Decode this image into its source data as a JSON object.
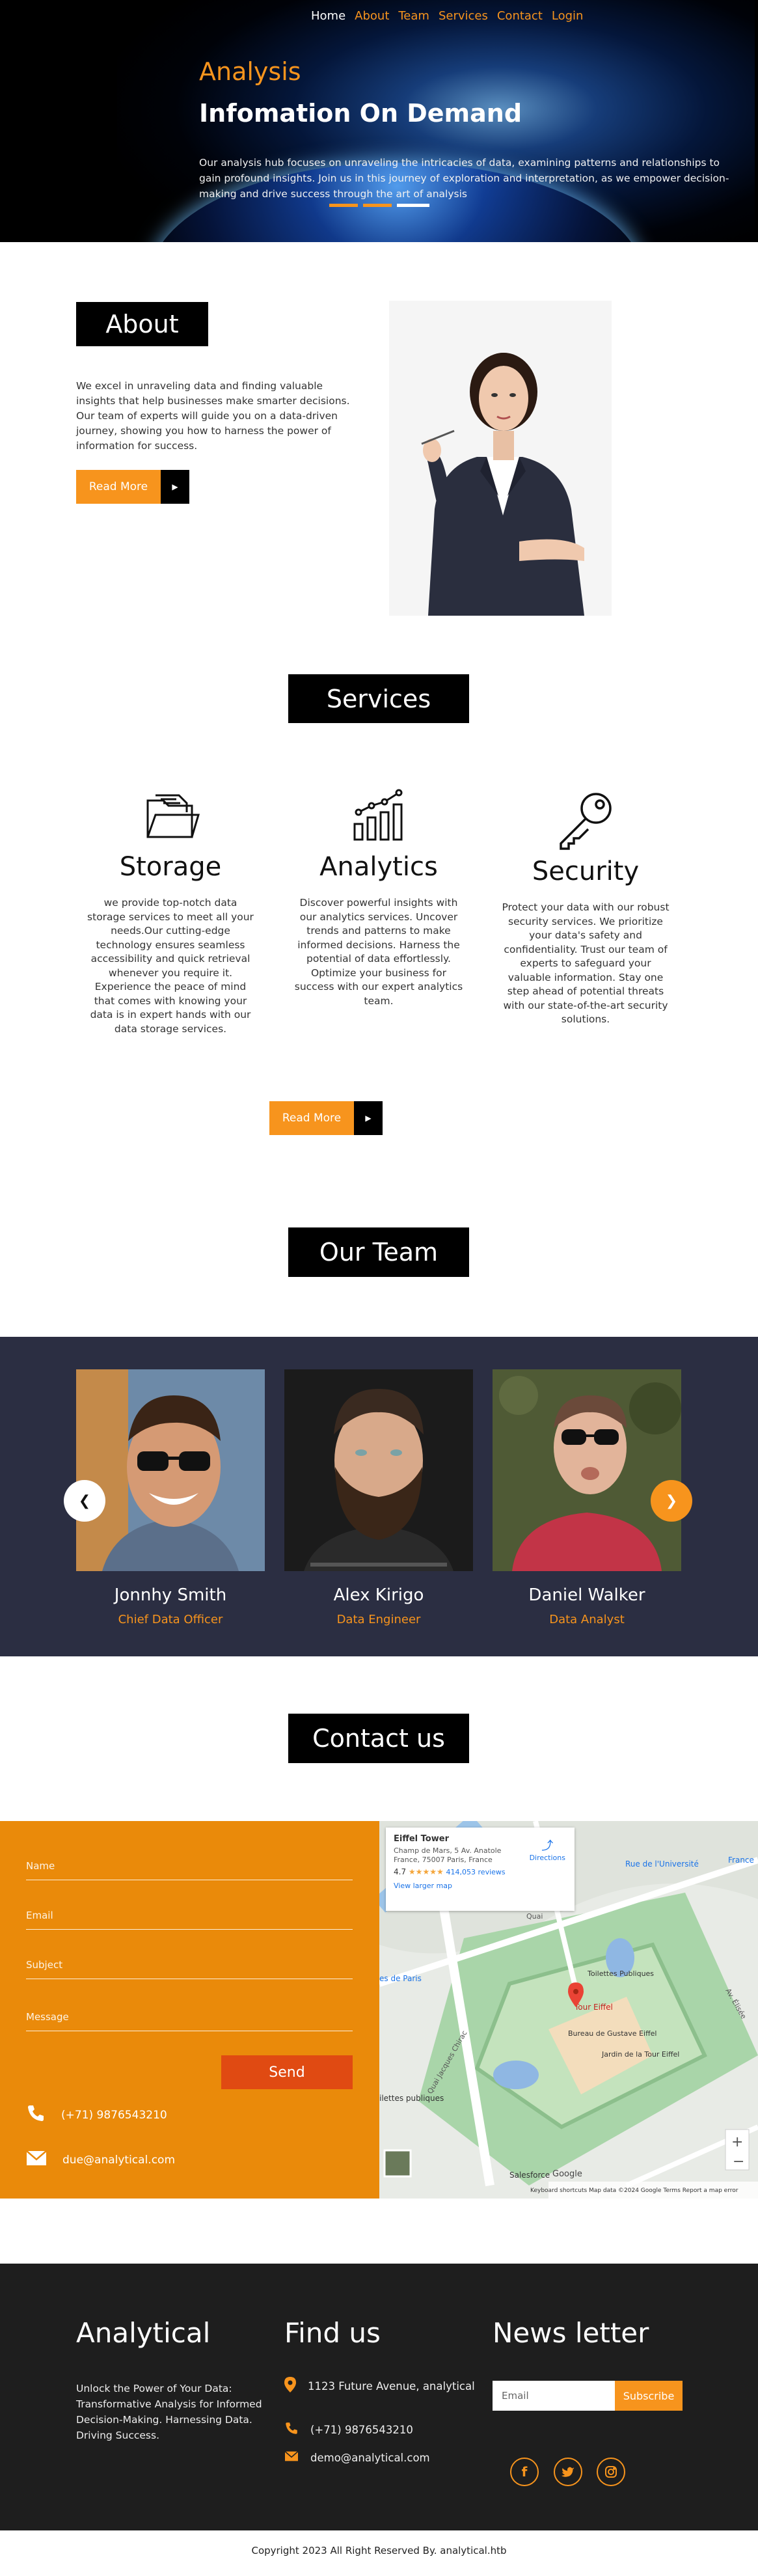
{
  "nav": {
    "items": [
      "Home",
      "About",
      "Team",
      "Services",
      "Contact",
      "Login"
    ]
  },
  "hero": {
    "kicker": "Analysis",
    "title": "Infomation On Demand",
    "lead": "Our analysis hub focuses on unraveling the intricacies of data, examining patterns and relationships to gain profound insights. Join us in this journey of exploration and interpretation, as we empower decision-making and drive success through the art of analysis"
  },
  "about": {
    "heading": "About",
    "text": "We excel in unraveling data and finding valuable insights that help businesses make smarter decisions. Our team of experts will guide you on a data-driven journey, showing you how to harness the power of information for success.",
    "button": "Read More"
  },
  "services": {
    "heading": "Services",
    "items": [
      {
        "title": "Storage",
        "icon": "folder-icon",
        "text": "we provide top-notch data storage services to meet all your needs.Our cutting-edge technology ensures seamless accessibility and quick retrieval whenever you require it. Experience the peace of mind that comes with knowing your data is in expert hands with our data storage services."
      },
      {
        "title": "Analytics",
        "icon": "bar-chart-icon",
        "text": "Discover powerful insights with our analytics services. Uncover trends and patterns to make informed decisions. Harness the potential of data effortlessly. Optimize your business for success with our expert analytics team."
      },
      {
        "title": "Security",
        "icon": "key-icon",
        "text": "Protect your data with our robust security services. We prioritize your data's safety and confidentiality. Trust our team of experts to safeguard your valuable information. Stay one step ahead of potential threats with our state-of-the-art security solutions."
      }
    ],
    "button": "Read More"
  },
  "team": {
    "heading": "Our Team",
    "members": [
      {
        "name": "Jonnhy Smith",
        "role": "Chief Data Officer"
      },
      {
        "name": "Alex Kirigo",
        "role": "Data Engineer"
      },
      {
        "name": "Daniel Walker",
        "role": "Data Analyst"
      }
    ]
  },
  "contact": {
    "heading": "Contact us",
    "fields": {
      "name": "Name",
      "email": "Email",
      "subject": "Subject",
      "message": "Message"
    },
    "send": "Send",
    "phone": "(+71) 9876543210",
    "email": "due@analytical.com"
  },
  "map": {
    "place": "Eiffel Tower",
    "address": "Champ de Mars, 5 Av. Anatole France, 75007 Paris, France",
    "rating": "4.7",
    "stars": "★★★★★",
    "reviews": "414,053 reviews",
    "directions": "Directions",
    "larger": "View larger map",
    "labels": {
      "universite": "Rue de l'Université",
      "france": "France",
      "tour": "Tour Eiffel",
      "toilettes": "Toilettes Publiques",
      "bureau": "Bureau de Gustave Eiffel",
      "jardin": "Jardin de la Tour Eiffel",
      "jacques": "Quai Jacques Chirac",
      "paris": "es de Paris",
      "toilettes2": "ilettes publiques",
      "salesforce": "Salesforce",
      "elisee": "Av. Élisée",
      "quai": "Quai"
    },
    "footer": "Keyboard shortcuts   Map data ©2024 Google   Terms   Report a map error",
    "google": "Google"
  },
  "footer": {
    "brand": "Analytical",
    "desc": "Unlock the Power of Your Data: Transformative Analysis for Informed Decision-Making. Harnessing Data. Driving Success.",
    "find_us": "Find us",
    "address": "1123 Future Avenue, analytical",
    "phone": "(+71) 9876543210",
    "email": "demo@analytical.com",
    "newsletter": "News letter",
    "email_placeholder": "Email",
    "subscribe": "Subscribe",
    "social": [
      "f",
      "t",
      "i"
    ]
  },
  "copyright": "Copyright 2023 All Right Reserved By. analytical.htb",
  "colors": {
    "accent": "#f7941d",
    "contact_bg": "#ea8a0a",
    "team_bg": "#2b2e42",
    "footer_bg": "#1e1e1e"
  }
}
